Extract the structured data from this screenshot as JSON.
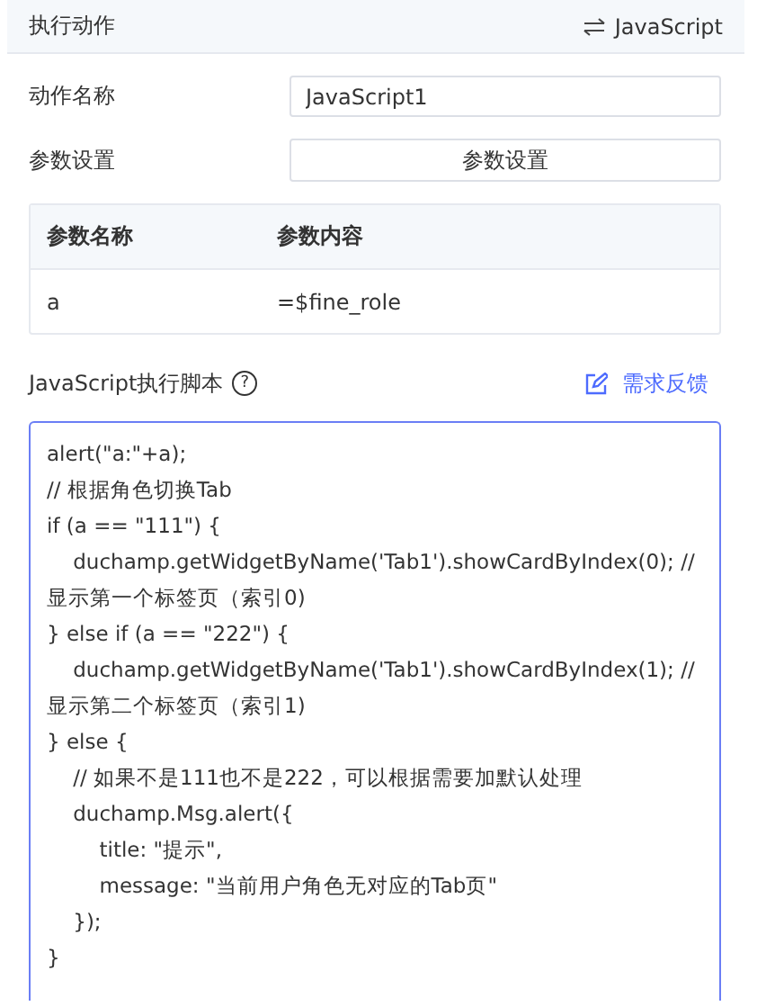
{
  "header": {
    "title": "执行动作",
    "switch_label": "JavaScript"
  },
  "action_name": {
    "label": "动作名称",
    "value": "JavaScript1"
  },
  "params": {
    "label": "参数设置",
    "button": "参数设置"
  },
  "table": {
    "columns": [
      "参数名称",
      "参数内容"
    ],
    "rows": [
      [
        "a",
        "=$fine_role"
      ]
    ]
  },
  "script": {
    "label": "JavaScript执行脚本",
    "help": "?",
    "feedback": "需求反馈",
    "code": "alert(\"a:\"+a);\n// 根据角色切换Tab\nif (a == \"111\") {\n    duchamp.getWidgetByName('Tab1').showCardByIndex(0); // 显示第一个标签页（索引0)\n} else if (a == \"222\") {\n    duchamp.getWidgetByName('Tab1').showCardByIndex(1); // 显示第二个标签页（索引1)\n} else {\n    // 如果不是111也不是222，可以根据需要加默认处理\n    duchamp.Msg.alert({\n        title: \"提示\",\n        message: \"当前用户角色无对应的Tab页\"\n    });\n}"
  }
}
